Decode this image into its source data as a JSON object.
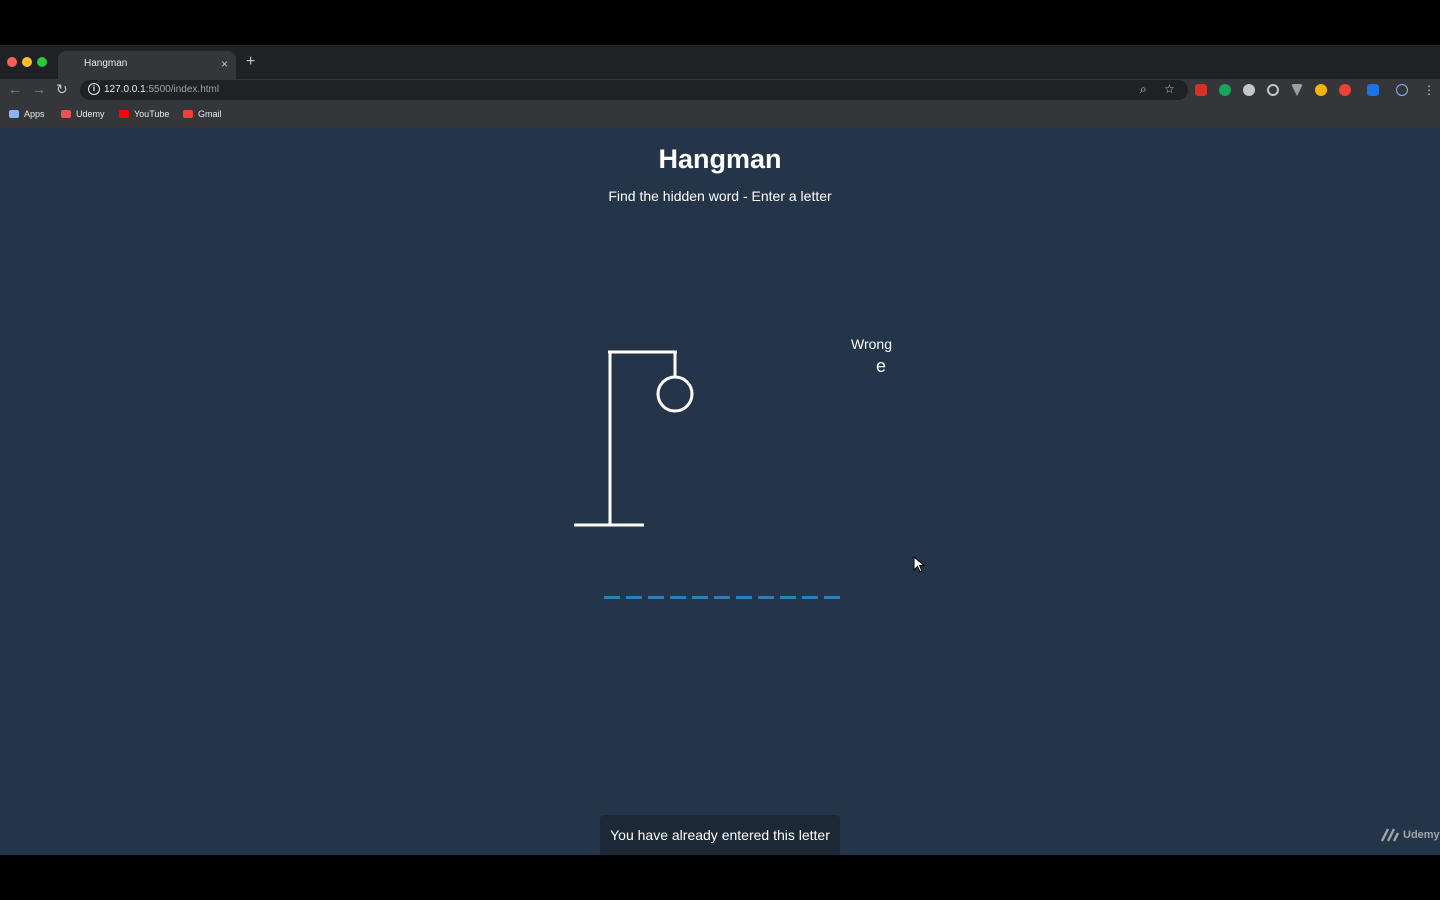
{
  "browser": {
    "tab_title": "Hangman",
    "tab_close": "×",
    "new_tab": "+",
    "url_host": "127.0.0.1",
    "url_path": ":5500/index.html",
    "bookmarks": [
      {
        "label": "Apps",
        "color": "#8ab4f8"
      },
      {
        "label": "Udemy",
        "color": "#ec5252"
      },
      {
        "label": "YouTube",
        "color": "#ff0000"
      },
      {
        "label": "Gmail",
        "color": "#ea4335"
      }
    ]
  },
  "game": {
    "title": "Hangman",
    "subtitle": "Find the hidden word - Enter a letter",
    "wrong_label": "Wrong",
    "wrong_letters": "e",
    "hidden_word_length": 11,
    "notification": "You have already entered this letter",
    "accent_color": "#2980b9",
    "background_color": "#253549"
  },
  "watermark": {
    "label": "Udemy"
  }
}
